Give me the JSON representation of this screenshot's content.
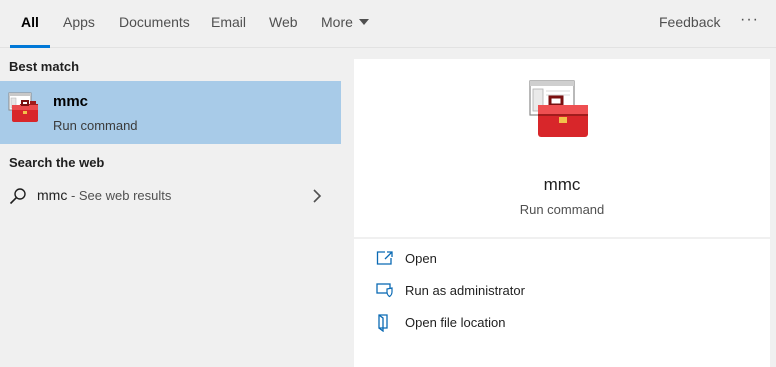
{
  "tabs": [
    {
      "label": "All",
      "active": true
    },
    {
      "label": "Apps"
    },
    {
      "label": "Documents"
    },
    {
      "label": "Email"
    },
    {
      "label": "Web"
    },
    {
      "label": "More"
    }
  ],
  "header": {
    "feedback_label": "Feedback",
    "more_options": "···"
  },
  "accent_color": "#0078d7",
  "selected_row_color": "#a8cbe8",
  "left": {
    "best_match_header": "Best match",
    "best_match": {
      "title": "mmc",
      "subtitle": "Run command",
      "icon": "toolbox-app-icon"
    },
    "web_header": "Search the web",
    "web_result": {
      "query": "mmc",
      "suffix": " - See web results",
      "icon": "search-icon"
    }
  },
  "detail": {
    "title": "mmc",
    "type": "Run command",
    "actions": [
      {
        "label": "Open",
        "icon": "open-icon"
      },
      {
        "label": "Run as administrator",
        "icon": "shield-icon"
      },
      {
        "label": "Open file location",
        "icon": "file-location-icon"
      }
    ]
  }
}
